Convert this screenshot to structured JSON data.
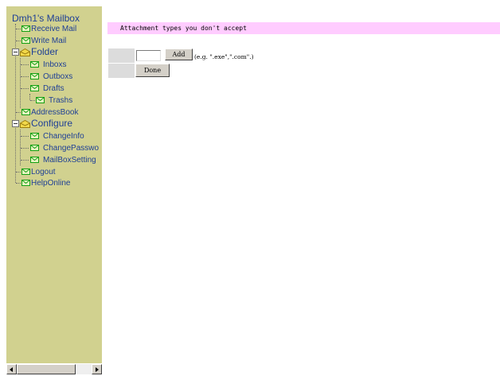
{
  "sidebar": {
    "title": "Dmh1's Mailbox",
    "items": {
      "receive": "Receive Mail",
      "write": "Write Mail",
      "folder": "Folder",
      "inboxs": "Inboxs",
      "outboxs": "Outboxs",
      "drafts": "Drafts",
      "trashs": "Trashs",
      "addressbook": "AddressBook",
      "configure": "Configure",
      "changeinfo": "ChangeInfo",
      "changepassword": "ChangePasswo",
      "mailboxsetting": "MailBoxSetting",
      "logout": "Logout",
      "helponline": "HelpOnline"
    }
  },
  "main": {
    "banner": "Attachment types you don't accept",
    "add_label": "Add",
    "done_label": "Done",
    "example_hint": "(e.g. \".exe\",\".com\".)",
    "input_value": ""
  },
  "colors": {
    "sidebar_bg": "#d1d18f",
    "banner_bg": "#ffccff",
    "link": "#1e3f96",
    "envelope": "#14a014"
  }
}
